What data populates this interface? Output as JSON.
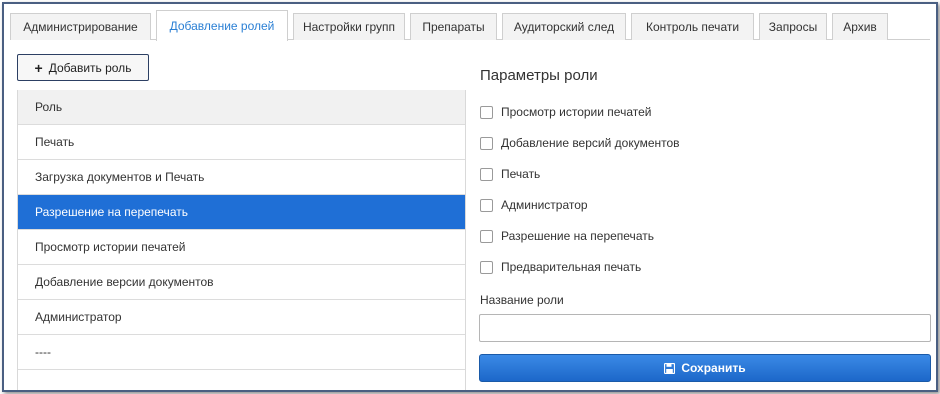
{
  "tabs": [
    {
      "label": "Администрирование",
      "active": false
    },
    {
      "label": "Добавление ролей",
      "active": true
    },
    {
      "label": "Настройки групп",
      "active": false
    },
    {
      "label": "Препараты",
      "active": false
    },
    {
      "label": "Аудиторский след",
      "active": false
    },
    {
      "label": "Контроль печати",
      "active": false
    },
    {
      "label": "Запросы",
      "active": false
    },
    {
      "label": "Архив",
      "active": false
    }
  ],
  "add_role_button": {
    "icon": "plus-icon",
    "label": "Добавить роль"
  },
  "roles_table": {
    "header": "Роль",
    "rows": [
      "Печать",
      "Загрузка документов и Печать",
      "Разрешение на перепечать",
      "Просмотр истории печатей",
      "Добавление версии документов",
      "Администратор",
      "----",
      ""
    ],
    "selected_index": 2
  },
  "params": {
    "title": "Параметры роли",
    "checkboxes": [
      {
        "label": "Просмотр истории печатей",
        "checked": false
      },
      {
        "label": "Добавление версий документов",
        "checked": false
      },
      {
        "label": "Печать",
        "checked": false
      },
      {
        "label": "Администратор",
        "checked": false
      },
      {
        "label": "Разрешение на перепечать",
        "checked": false
      },
      {
        "label": "Предварительная печать",
        "checked": false
      }
    ],
    "name_label": "Название роли",
    "name_value": "",
    "save_button": {
      "icon": "floppy-disk-icon",
      "label": "Сохранить"
    }
  },
  "colors": {
    "accent": "#1f6fd6",
    "active_tab_text": "#2a7fd4",
    "frame_border": "#4a5f82"
  }
}
